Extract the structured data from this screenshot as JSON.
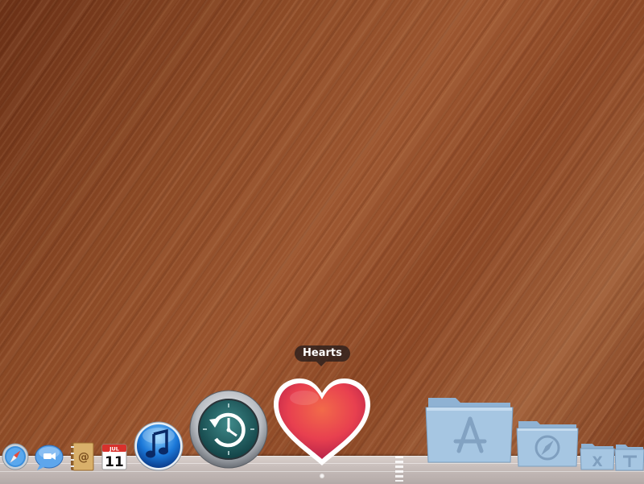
{
  "desktop": {
    "wallpaper": "wood",
    "wood_colors": [
      "#6a3016",
      "#9c5630",
      "#7a3a1c"
    ]
  },
  "tooltip": {
    "label": "Hearts"
  },
  "dock": {
    "apps": [
      {
        "name": "Safari",
        "icon": "safari-compass-icon"
      },
      {
        "name": "iChat",
        "icon": "ichat-bubble-icon"
      },
      {
        "name": "Address Book",
        "icon": "address-book-icon"
      },
      {
        "name": "iCal",
        "icon": "ical-calendar-icon",
        "month": "JUL",
        "day": "11"
      },
      {
        "name": "iTunes",
        "icon": "itunes-note-icon"
      },
      {
        "name": "Time Machine",
        "icon": "time-machine-icon"
      },
      {
        "name": "Hearts",
        "icon": "heart-icon",
        "hovered": true
      }
    ],
    "stacks": [
      {
        "name": "Applications",
        "icon": "applications-folder-icon"
      },
      {
        "name": "Web folder",
        "icon": "safari-folder-icon"
      },
      {
        "name": "X folder",
        "icon": "x-folder-icon"
      },
      {
        "name": "Utilities folder",
        "icon": "utilities-folder-icon"
      }
    ],
    "colors": {
      "folder": "#a6c6e2",
      "heart": "#e8404f",
      "itunes": "#1b78d8"
    }
  }
}
